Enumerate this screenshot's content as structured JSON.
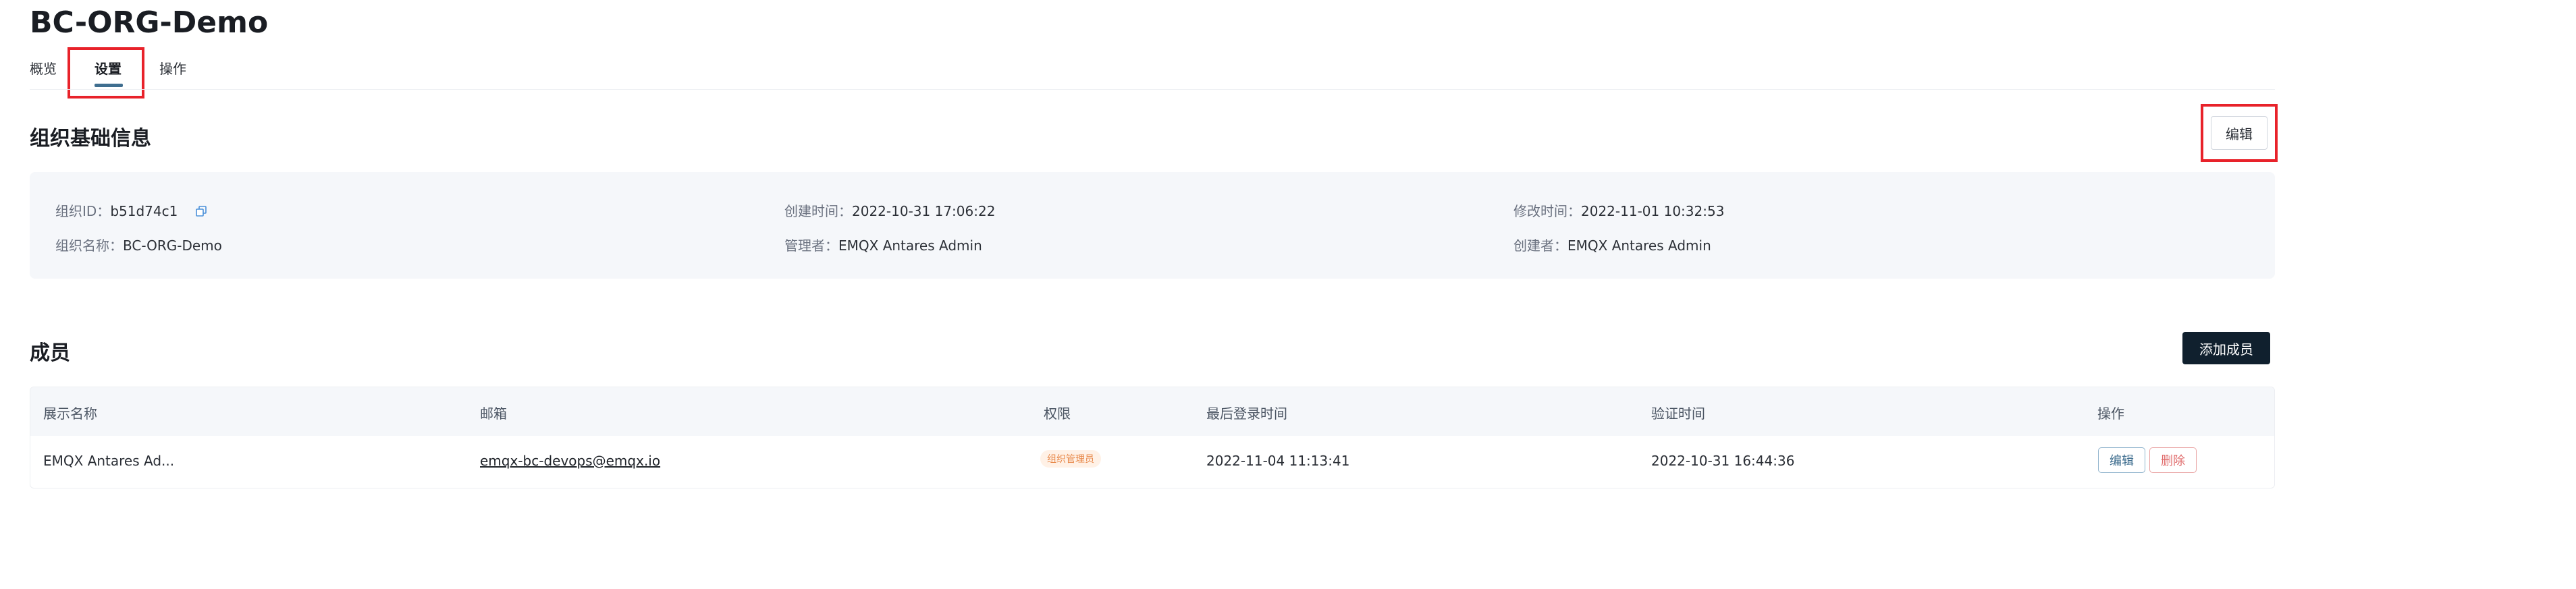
{
  "page": {
    "title": "BC-ORG-Demo"
  },
  "tabs": [
    {
      "label": "概览"
    },
    {
      "label": "设置"
    },
    {
      "label": "操作"
    }
  ],
  "org_info": {
    "section_title": "组织基础信息",
    "edit_label": "编辑",
    "fields": [
      {
        "label": "组织ID：",
        "value": "b51d74c1"
      },
      {
        "label": "创建时间：",
        "value": "2022-10-31 17:06:22"
      },
      {
        "label": "修改时间：",
        "value": "2022-11-01 10:32:53"
      },
      {
        "label": "组织名称：",
        "value": "BC-ORG-Demo"
      },
      {
        "label": "管理者：",
        "value": "EMQX Antares Admin"
      },
      {
        "label": "创建者：",
        "value": "EMQX Antares Admin"
      }
    ]
  },
  "members": {
    "section_title": "成员",
    "add_label": "添加成员",
    "columns": [
      "展示名称",
      "邮箱",
      "权限",
      "最后登录时间",
      "验证时间",
      "操作"
    ],
    "rows": [
      {
        "name": "EMQX Antares Ad...",
        "email": "emqx-bc-devops@emqx.io",
        "role": "组织管理员",
        "last_login": "2022-11-04 11:13:41",
        "verified": "2022-10-31 16:44:36",
        "edit_label": "编辑",
        "delete_label": "删除"
      }
    ]
  },
  "colors": {
    "accent": "#3f6e8f",
    "highlight": "#e8222a",
    "dark_button": "#10202e",
    "danger": "#e06a6a"
  },
  "icons": {
    "copy": "copy-icon"
  }
}
